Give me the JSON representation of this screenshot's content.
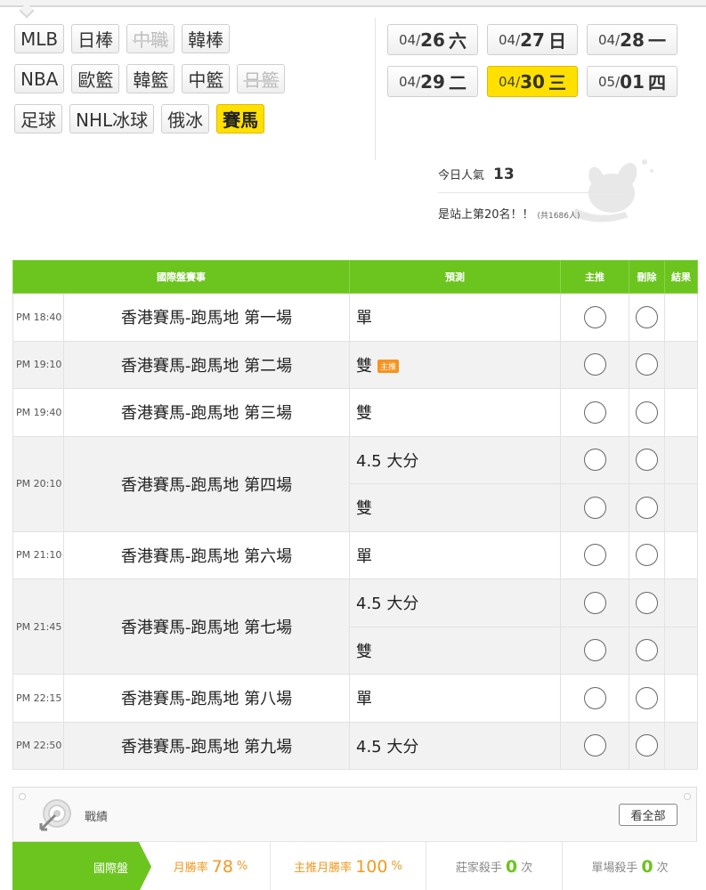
{
  "sports": {
    "row1": [
      {
        "label": "MLB",
        "state": "normal"
      },
      {
        "label": "日棒",
        "state": "normal"
      },
      {
        "label": "中職",
        "state": "disabled"
      },
      {
        "label": "韓棒",
        "state": "normal"
      }
    ],
    "row2": [
      {
        "label": "NBA",
        "state": "normal"
      },
      {
        "label": "歐籃",
        "state": "normal"
      },
      {
        "label": "韓籃",
        "state": "normal"
      },
      {
        "label": "中籃",
        "state": "normal"
      },
      {
        "label": "日籃",
        "state": "disabled"
      }
    ],
    "row3": [
      {
        "label": "足球",
        "state": "normal"
      },
      {
        "label": "NHL冰球",
        "state": "normal"
      },
      {
        "label": "俄冰",
        "state": "normal"
      },
      {
        "label": "賽馬",
        "state": "active"
      }
    ]
  },
  "dates": [
    {
      "md": "04/",
      "dd": "26",
      "wd": "六",
      "active": false
    },
    {
      "md": "04/",
      "dd": "27",
      "wd": "日",
      "active": false
    },
    {
      "md": "04/",
      "dd": "28",
      "wd": "一",
      "active": false
    },
    {
      "md": "04/",
      "dd": "29",
      "wd": "二",
      "active": false
    },
    {
      "md": "04/",
      "dd": "30",
      "wd": "三",
      "active": true
    },
    {
      "md": "05/",
      "dd": "01",
      "wd": "四",
      "active": false
    }
  ],
  "popularity": {
    "label": "今日人氣",
    "count": "13",
    "rank_text": "是站上第20名！！",
    "total_text": "(共1686人)"
  },
  "table": {
    "headers": {
      "event": "國際盤賽事",
      "prediction": "預測",
      "main_pick": "主推",
      "delete": "刪除",
      "result": "結果"
    },
    "main_badge": "主推",
    "games": [
      {
        "time": "PM 18:40",
        "match": "香港賽馬-跑馬地 第一場",
        "picks": [
          {
            "text": "單",
            "badge": false
          }
        ]
      },
      {
        "time": "PM 19:10",
        "match": "香港賽馬-跑馬地 第二場",
        "picks": [
          {
            "text": "雙",
            "badge": true
          }
        ]
      },
      {
        "time": "PM 19:40",
        "match": "香港賽馬-跑馬地 第三場",
        "picks": [
          {
            "text": "雙",
            "badge": false
          }
        ]
      },
      {
        "time": "PM 20:10",
        "match": "香港賽馬-跑馬地 第四場",
        "picks": [
          {
            "text": "4.5 大分",
            "badge": false
          },
          {
            "text": "雙",
            "badge": false
          }
        ]
      },
      {
        "time": "PM 21:10",
        "match": "香港賽馬-跑馬地 第六場",
        "picks": [
          {
            "text": "單",
            "badge": false
          }
        ]
      },
      {
        "time": "PM 21:45",
        "match": "香港賽馬-跑馬地 第七場",
        "picks": [
          {
            "text": "4.5 大分",
            "badge": false
          },
          {
            "text": "雙",
            "badge": false
          }
        ]
      },
      {
        "time": "PM 22:15",
        "match": "香港賽馬-跑馬地 第八場",
        "picks": [
          {
            "text": "單",
            "badge": false
          }
        ]
      },
      {
        "time": "PM 22:50",
        "match": "香港賽馬-跑馬地 第九場",
        "picks": [
          {
            "text": "4.5 大分",
            "badge": false
          }
        ]
      }
    ]
  },
  "record": {
    "title": "戰績",
    "see_all": "看全部",
    "category": "國際盤",
    "stats": [
      {
        "label": "月勝率",
        "value": "78",
        "unit": "%"
      },
      {
        "label": "主推月勝率",
        "value": "100",
        "unit": "%"
      },
      {
        "label": "莊家殺手",
        "value": "0",
        "unit": "次"
      },
      {
        "label": "單場殺手",
        "value": "0",
        "unit": "次"
      }
    ]
  },
  "colors": {
    "brand_green": "#6cc41f",
    "active_yellow": "#ffe000",
    "accent_orange": "#f39a21"
  }
}
